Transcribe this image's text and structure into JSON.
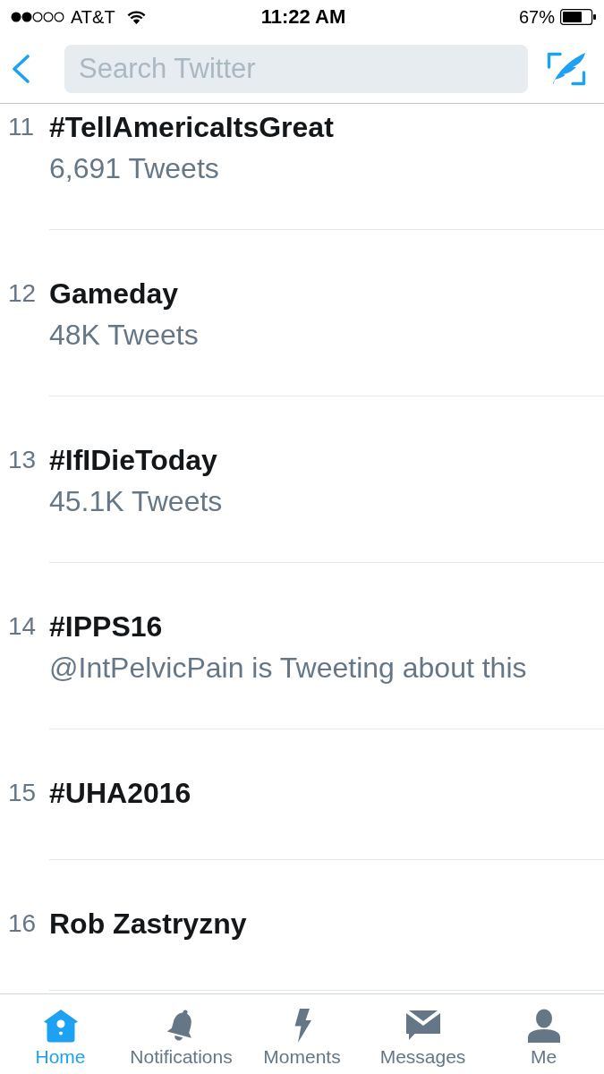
{
  "status_bar": {
    "carrier": "AT&T",
    "time": "11:22 AM",
    "battery": "67%"
  },
  "nav_bar": {
    "search": {
      "placeholder": "Search Twitter"
    }
  },
  "trends": [
    {
      "rank": "11",
      "name": "#TellAmericaItsGreat",
      "meta": "6,691 Tweets"
    },
    {
      "rank": "12",
      "name": "Gameday",
      "meta": "48K Tweets"
    },
    {
      "rank": "13",
      "name": "#IfIDieToday",
      "meta": "45.1K Tweets"
    },
    {
      "rank": "14",
      "name": "#IPPS16",
      "meta": "@IntPelvicPain is Tweeting about this"
    },
    {
      "rank": "15",
      "name": "#UHA2016"
    },
    {
      "rank": "16",
      "name": "Rob Zastryzny"
    }
  ],
  "tab_bar": [
    {
      "label": "Home",
      "selected": true
    },
    {
      "label": "Notifications",
      "selected": false
    },
    {
      "label": "Moments",
      "selected": false
    },
    {
      "label": "Messages",
      "selected": false
    },
    {
      "label": "Me",
      "selected": false
    }
  ]
}
